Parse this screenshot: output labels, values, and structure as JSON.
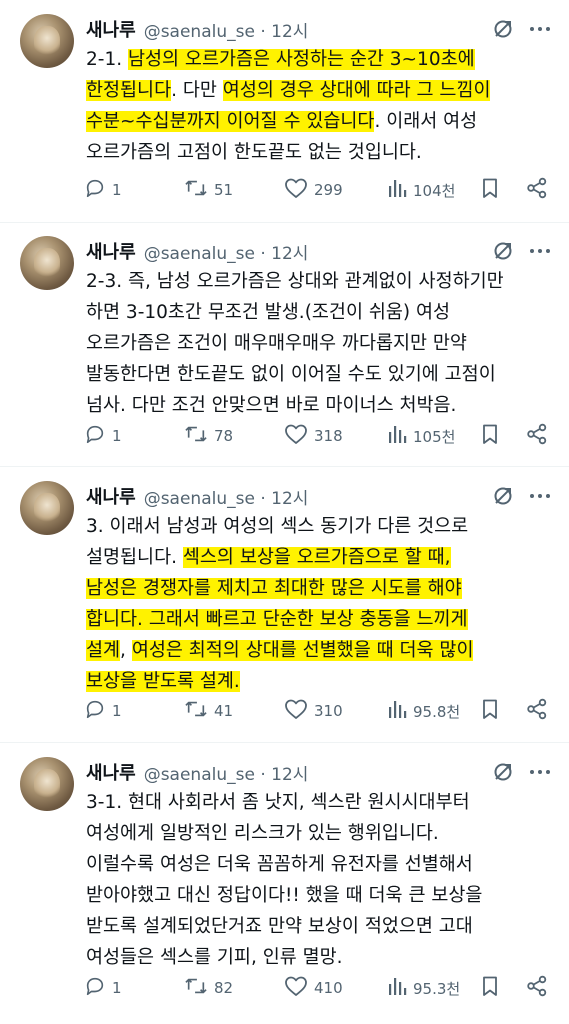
{
  "posts": [
    {
      "name": "새나루",
      "handle": "@saenalu_se · 12시",
      "lines": [
        [
          {
            "t": "2-1. ",
            "h": false
          },
          {
            "t": "남성의 오르가즘은 사정하는 순간 3~10초에",
            "h": true
          }
        ],
        [
          {
            "t": "한정됩니다",
            "h": true
          },
          {
            "t": ". 다만 ",
            "h": false
          },
          {
            "t": "여성의 경우 상대에 따라 그 느낌이",
            "h": true
          }
        ],
        [
          {
            "t": "수분~수십분까지 이어질 수 있습니다",
            "h": true
          },
          {
            "t": ". 이래서 여성",
            "h": false
          }
        ],
        [
          {
            "t": "오르가즘의 고점이 한도끝도 없는 것입니다.",
            "h": false
          }
        ]
      ],
      "replies": "1",
      "reposts": "51",
      "likes": "299",
      "views": "104천"
    },
    {
      "name": "새나루",
      "handle": "@saenalu_se · 12시",
      "lines": [
        [
          {
            "t": "2-3. 즉, 남성 오르가즘은 상대와 관계없이 사정하기만",
            "h": false
          }
        ],
        [
          {
            "t": "하면 3-10초간 무조건 발생.(조건이 쉬움) 여성",
            "h": false
          }
        ],
        [
          {
            "t": "오르가즘은 조건이 매우매우매우 까다롭지만 만약",
            "h": false
          }
        ],
        [
          {
            "t": "발동한다면 한도끝도 없이 이어질 수도 있기에 고점이",
            "h": false
          }
        ],
        [
          {
            "t": "넘사. 다만 조건 안맞으면 바로 마이너스 처박음.",
            "h": false
          }
        ]
      ],
      "replies": "1",
      "reposts": "78",
      "likes": "318",
      "views": "105천"
    },
    {
      "name": "새나루",
      "handle": "@saenalu_se · 12시",
      "lines": [
        [
          {
            "t": "3. 이래서 남성과 여성의 섹스 동기가 다른 것으로",
            "h": false
          }
        ],
        [
          {
            "t": "설명됩니다. ",
            "h": false
          },
          {
            "t": "섹스의 보상을 오르가즘으로 할 때,",
            "h": true
          }
        ],
        [
          {
            "t": "남성은 경쟁자를 제치고 최대한 많은 시도를 해야",
            "h": true
          }
        ],
        [
          {
            "t": "합니다. 그래서 빠르고 단순한 보상 충동을 느끼게",
            "h": true
          }
        ],
        [
          {
            "t": "설계",
            "h": true
          },
          {
            "t": ", ",
            "h": false
          },
          {
            "t": "여성은 최적의 상대를 선별했을 때 더욱 많이",
            "h": true
          }
        ],
        [
          {
            "t": "보상을 받도록 설계.",
            "h": true
          }
        ]
      ],
      "replies": "1",
      "reposts": "41",
      "likes": "310",
      "views": "95.8천"
    },
    {
      "name": "새나루",
      "handle": "@saenalu_se · 12시",
      "lines": [
        [
          {
            "t": "3-1. 현대 사회라서 좀 낫지, 섹스란 원시시대부터",
            "h": false
          }
        ],
        [
          {
            "t": "여성에게 일방적인 리스크가 있는 행위입니다.",
            "h": false
          }
        ],
        [
          {
            "t": "이럴수록 여성은 더욱 꼼꼼하게 유전자를 선별해서",
            "h": false
          }
        ],
        [
          {
            "t": "받아야했고 대신 정답이다!! 했을 때 더욱 큰 보상을",
            "h": false
          }
        ],
        [
          {
            "t": "받도록 설계되었단거죠 만약 보상이 적었으면 고대",
            "h": false
          }
        ],
        [
          {
            "t": "여성들은 섹스를 기피, 인류 멸망.",
            "h": false
          }
        ]
      ],
      "replies": "1",
      "reposts": "82",
      "likes": "410",
      "views": "95.3천"
    }
  ]
}
